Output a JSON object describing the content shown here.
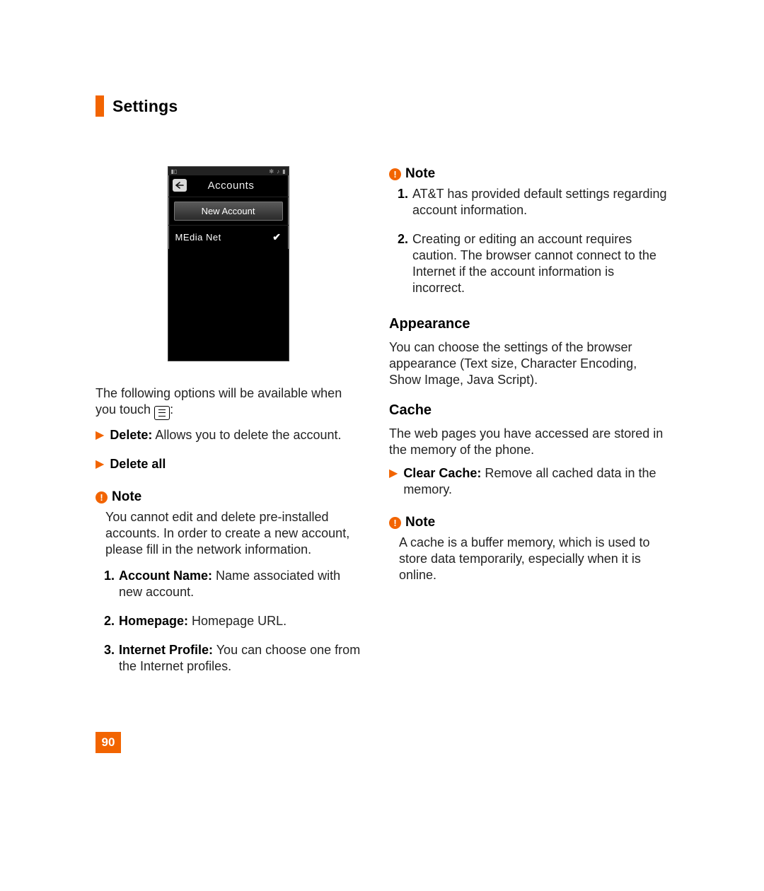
{
  "header": {
    "title": "Settings"
  },
  "page_number": "90",
  "phone": {
    "screen_title": "Accounts",
    "new_account_label": "New Account",
    "entry": "MEdia Net"
  },
  "left": {
    "intro_pre": "The following options will be available when you touch ",
    "intro_post": ":",
    "delete_label": "Delete:",
    "delete_desc": " Allows you to delete the account.",
    "delete_all_label": "Delete all",
    "note1_title": "Note",
    "note1_body": "You cannot edit and delete pre-installed accounts. In order to create a new account, please fill in the network information.",
    "fields": [
      {
        "n": "1.",
        "label": "Account Name:",
        "desc": " Name associated with new account."
      },
      {
        "n": "2.",
        "label": "Homepage:",
        "desc": " Homepage URL."
      },
      {
        "n": "3.",
        "label": "Internet Profile:",
        "desc": " You can choose one from the Internet profiles."
      }
    ]
  },
  "right": {
    "note2_title": "Note",
    "note2_items": [
      {
        "n": "1.",
        "text": "AT&T has provided default settings regarding account information."
      },
      {
        "n": "2.",
        "text": "Creating or editing an account requires caution. The browser cannot connect to the Internet if the account information is incorrect."
      }
    ],
    "appearance_title": "Appearance",
    "appearance_body": "You can choose the settings of the browser appearance (Text size, Character Encoding, Show Image, Java Script).",
    "cache_title": "Cache",
    "cache_body": "The web pages you have accessed are stored in the memory of the phone.",
    "clear_cache_label": "Clear Cache:",
    "clear_cache_desc": " Remove all cached data in the memory.",
    "note3_title": "Note",
    "note3_body": "A cache is a buffer memory, which is used to store data temporarily, especially when it is online."
  }
}
